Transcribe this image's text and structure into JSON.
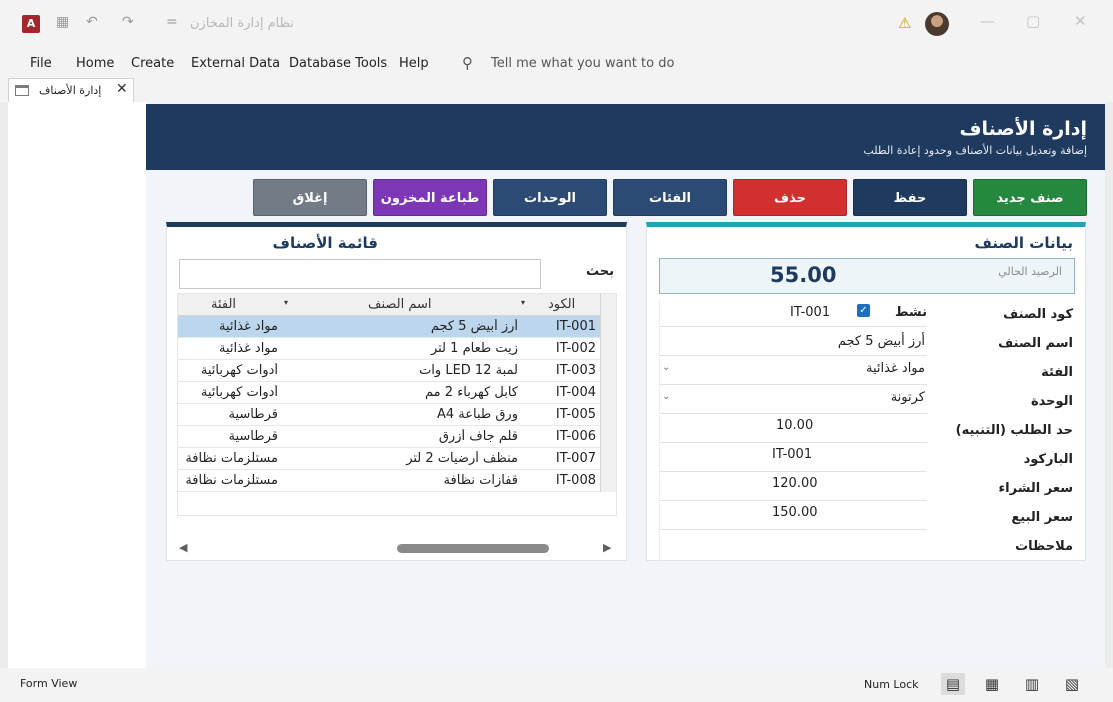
{
  "window": {
    "title": "نظام إدارة المخازن",
    "app_icon_letter": "A",
    "qa_undo": "↶",
    "qa_redo": "↷",
    "qa_save": "▦",
    "qa_more": "="
  },
  "menu": {
    "items": [
      "File",
      "Home",
      "Create",
      "External Data",
      "Database Tools",
      "Help"
    ],
    "tell_me": "Tell me what you want to do"
  },
  "tab": {
    "label": "إدارة الأصناف"
  },
  "header": {
    "title": "إدارة الأصناف",
    "subtitle": "إضافة وتعديل بيانات الأصناف وحدود إعادة الطلب"
  },
  "toolbar": {
    "new_item": "صنف جديد",
    "save": "حفظ",
    "delete": "حذف",
    "categories": "الفئات",
    "units": "الوحدات",
    "print_stock": "طباعة المخزون",
    "close": "إغلاق"
  },
  "colors": {
    "header_bg": "#1f3a5f",
    "new_btn": "#24883e",
    "save_btn": "#1f3a5f",
    "delete_btn": "#d2302e",
    "nav_btn": "#2b4b75",
    "print_btn": "#7d36b5",
    "close_btn": "#737b86",
    "accent_teal": "#2a9fb8"
  },
  "item_panel": {
    "title": "بيانات الصنف",
    "balance_label": "الرصيد الحالي",
    "balance_value": "55.00",
    "labels": {
      "code": "كود الصنف",
      "active": "نشط",
      "name": "اسم الصنف",
      "category": "الفئة",
      "unit": "الوحدة",
      "reorder": "حد الطلب (التنبيه)",
      "barcode": "الباركود",
      "buy_price": "سعر الشراء",
      "sell_price": "سعر البيع",
      "notes": "ملاحظات"
    },
    "values": {
      "code": "IT-001",
      "active_check": "✓",
      "name": "أرز أبيض 5 كجم",
      "category": "مواد غذائية",
      "unit": "كرتونة",
      "reorder": "10.00",
      "barcode": "IT-001",
      "buy_price": "120.00",
      "sell_price": "150.00",
      "notes": ""
    }
  },
  "list_panel": {
    "title": "قائمة الأصناف",
    "search_label": "بحث",
    "search_value": "",
    "columns": {
      "code": "الكود",
      "name": "اسم الصنف",
      "category": "الفئة"
    },
    "rows": [
      {
        "code": "IT-001",
        "name": "أرز أبيض 5 كجم",
        "category": "مواد غذائية"
      },
      {
        "code": "IT-002",
        "name": "زيت طعام 1 لتر",
        "category": "مواد غذائية"
      },
      {
        "code": "IT-003",
        "name": "لمبة LED 12 وات",
        "category": "أدوات كهربائية"
      },
      {
        "code": "IT-004",
        "name": "كابل كهرباء 2 مم",
        "category": "أدوات كهربائية"
      },
      {
        "code": "IT-005",
        "name": "ورق طباعة A4",
        "category": "قرطاسية"
      },
      {
        "code": "IT-006",
        "name": "قلم جاف أزرق",
        "category": "قرطاسية"
      },
      {
        "code": "IT-007",
        "name": "منظف أرضيات 2 لتر",
        "category": "مستلزمات نظافة"
      },
      {
        "code": "IT-008",
        "name": "قفازات نظافة",
        "category": "مستلزمات نظافة"
      }
    ]
  },
  "status": {
    "left": "Form View",
    "numlock": "Num Lock"
  }
}
